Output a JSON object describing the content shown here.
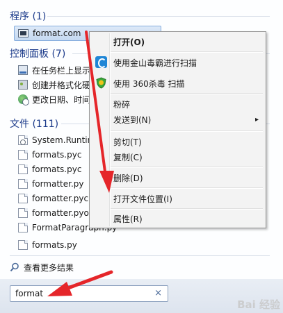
{
  "sections": {
    "programs": {
      "title": "程序 (1)",
      "items": [
        {
          "label": "format.com",
          "icon": "console-app-icon"
        }
      ]
    },
    "control_panel": {
      "title": "控制面板 (7)",
      "items": [
        {
          "label": "在任务栏上显示",
          "icon": "taskbar-icon"
        },
        {
          "label": "创建并格式化硬",
          "icon": "disk-management-icon"
        },
        {
          "label": "更改日期、时间",
          "icon": "globe-clock-icon"
        }
      ]
    },
    "files": {
      "title": "文件 (111)",
      "items": [
        {
          "label": "System.Runtim",
          "icon": "config-file-icon"
        },
        {
          "label": "formats.pyc",
          "icon": "file-icon"
        },
        {
          "label": "formats.pyc",
          "icon": "file-icon"
        },
        {
          "label": "formatter.py",
          "icon": "file-icon"
        },
        {
          "label": "formatter.pyc",
          "icon": "file-icon"
        },
        {
          "label": "formatter.pyo",
          "icon": "file-icon"
        },
        {
          "label": "FormatParagraph.py",
          "icon": "file-icon"
        },
        {
          "label": "formats.py",
          "icon": "file-icon"
        }
      ]
    }
  },
  "see_more": "查看更多结果",
  "search": {
    "value": "format",
    "clear_glyph": "×"
  },
  "context_menu": {
    "items": [
      {
        "label": "打开(O)",
        "bold": true
      },
      {
        "label": "使用金山毒霸进行扫描",
        "icon": "kingsoft-scan-icon"
      },
      {
        "label": "使用 360杀毒 扫描",
        "icon": "360-shield-icon"
      },
      {
        "label": "粉碎"
      },
      {
        "label": "发送到(N)",
        "submenu": true
      },
      {
        "label": "剪切(T)"
      },
      {
        "label": "复制(C)"
      },
      {
        "label": "删除(D)"
      },
      {
        "label": "打开文件位置(I)"
      },
      {
        "label": "属性(R)"
      }
    ],
    "submenu_glyph": "▸"
  },
  "annotation_color": "#e5262a",
  "watermark": "Bai 经验"
}
